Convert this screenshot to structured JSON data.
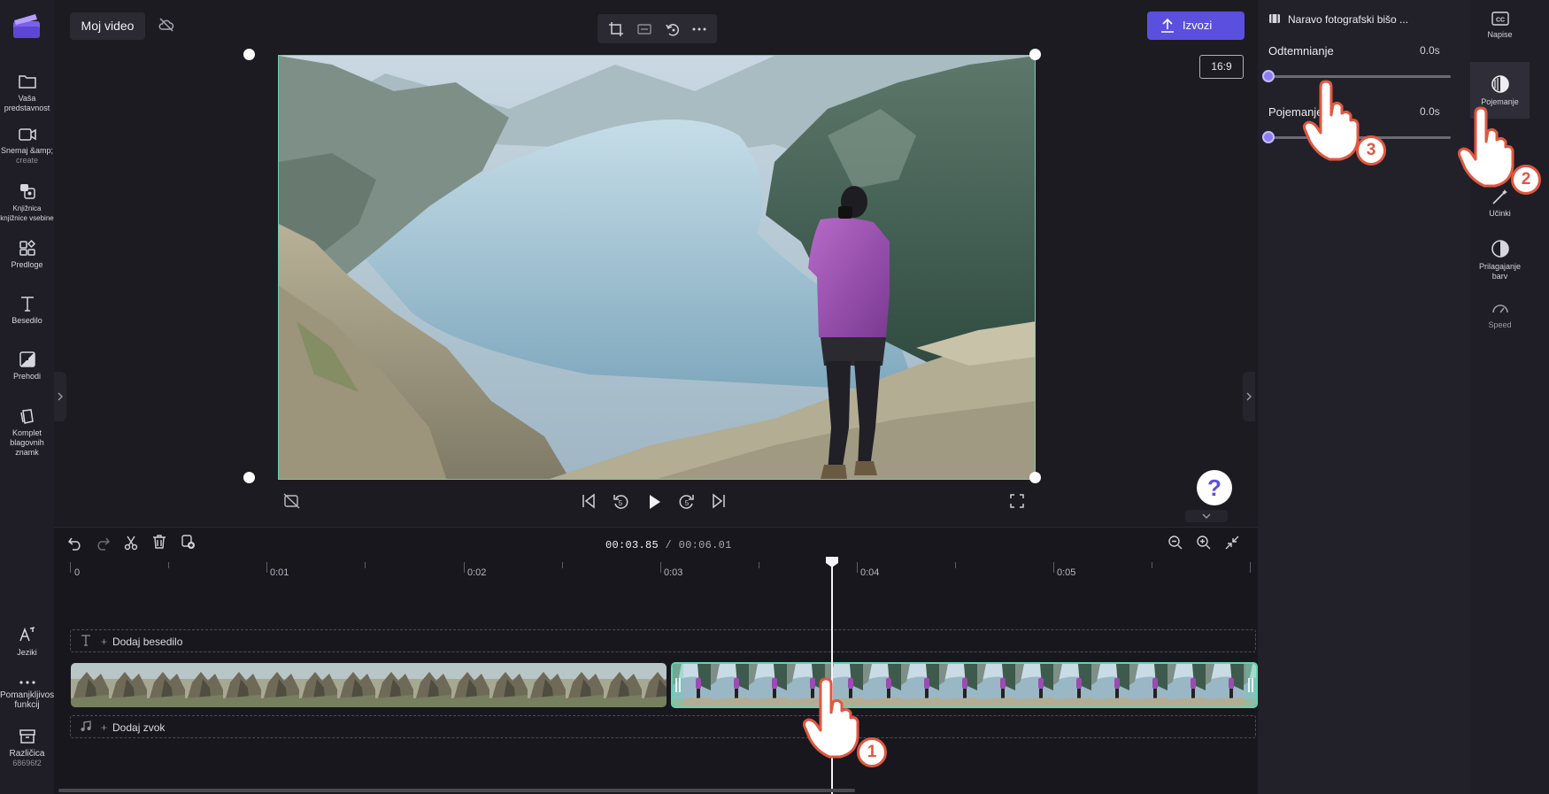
{
  "app": {
    "project_name": "Moj video",
    "export_label": "Izvozi",
    "aspect_ratio": "16:9",
    "colors": {
      "accent": "#5b4fe0",
      "selection": "#62d4b0",
      "callout": "#e25740"
    }
  },
  "sidebar": {
    "items": [
      {
        "label": "Vaša predstavnost",
        "icon": "folder-icon"
      },
      {
        "label": "Snemaj &amp;",
        "sub": "create",
        "icon": "camera-icon"
      },
      {
        "label": "Knjižnica knjižnice vsebine",
        "icon": "library-icon"
      },
      {
        "label": "Predloge",
        "icon": "templates-icon"
      },
      {
        "label": "Besedilo",
        "icon": "text-icon"
      },
      {
        "label": "Prehodi",
        "icon": "transitions-icon"
      },
      {
        "label": "Komplet blagovnih znamk",
        "icon": "brand-kit-icon"
      }
    ],
    "bottom": [
      {
        "label": "Jeziki",
        "icon": "languages-icon"
      },
      {
        "label": "Pomanjkljivosti funkcij",
        "icon": "more-icon"
      },
      {
        "label": "Različica",
        "sub": "68696f2",
        "icon": "version-icon"
      }
    ]
  },
  "timeline": {
    "current_time": "00:03.85",
    "separator": "/",
    "total_time": "00:06.01",
    "ruler": [
      "0",
      "0:01",
      "0:02",
      "0:03",
      "0:04",
      "0:05"
    ],
    "add_text": "Dodaj besedilo",
    "add_audio": "Dodaj zvok",
    "add_prefix": "+"
  },
  "right_panel": {
    "clip_title": "Naravo fotografski bišo ...",
    "fade_out": {
      "label": "Odtemnianje",
      "value": "0.0s"
    },
    "fade_in": {
      "label": "Pojemanje",
      "value": "0.0s"
    },
    "tabs": [
      {
        "label": "Napise",
        "icon": "captions-icon"
      },
      {
        "label": "Pojemanje",
        "icon": "fade-icon"
      },
      {
        "label": "Učinki",
        "icon": "effects-icon"
      },
      {
        "label": "Prilagajanje barv",
        "icon": "color-adjust-icon"
      },
      {
        "label": "Speed",
        "icon": "speed-icon"
      }
    ]
  },
  "callouts": {
    "step1": "1",
    "step2": "2",
    "step3": "3"
  },
  "help": {
    "label": "?"
  }
}
